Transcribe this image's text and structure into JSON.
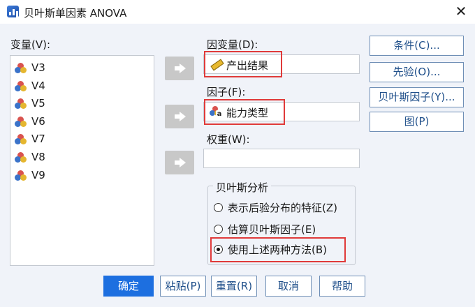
{
  "window": {
    "title": "贝叶斯单因素 ANOVA",
    "close": "✕"
  },
  "variables": {
    "label": "变量(V):",
    "items": [
      "V3",
      "V4",
      "V5",
      "V6",
      "V7",
      "V8",
      "V9"
    ]
  },
  "dependent": {
    "label": "因变量(D):",
    "value": "产出结果",
    "icon": "scale-ruler-icon"
  },
  "factor": {
    "label": "因子(F):",
    "value": "能力类型",
    "icon": "nominal-variable-icon"
  },
  "weight": {
    "label": "权重(W):",
    "value": ""
  },
  "side_buttons": {
    "conditions": "条件(C)...",
    "priors": "先验(O)...",
    "bayes_factor": "贝叶斯因子(Y)...",
    "plots": "图(P)"
  },
  "analysis": {
    "title": "贝叶斯分析",
    "options": [
      {
        "label": "表示后验分布的特征(Z)",
        "selected": false
      },
      {
        "label": "估算贝叶斯因子(E)",
        "selected": false
      },
      {
        "label": "使用上述两种方法(B)",
        "selected": true
      }
    ]
  },
  "footer": {
    "ok": "确定",
    "paste": "粘贴(P)",
    "reset": "重置(R)",
    "cancel": "取消",
    "help": "帮助"
  },
  "colors": {
    "primary": "#1d6fe0",
    "highlight": "#e03a3a",
    "text_link": "#1f4f8a"
  }
}
